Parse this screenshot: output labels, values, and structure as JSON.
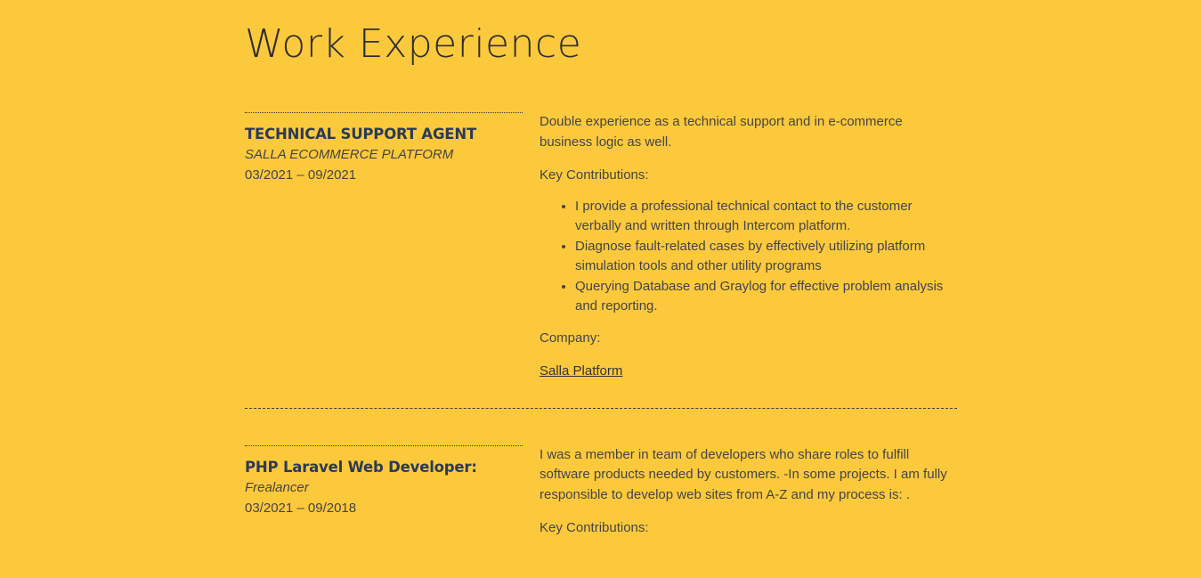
{
  "section": {
    "title": "Work Experience"
  },
  "jobs": [
    {
      "title": "TECHNICAL SUPPORT AGENT",
      "company": "SALLA ECOMMERCE PLATFORM",
      "dates": "03/2021 – 09/2021",
      "intro": "Double experience as a technical support and in e-commerce business logic as well.",
      "key_label": "Key Contributions:",
      "contributions": [
        "I provide a professional technical contact to the customer verbally and written through Intercom platform.",
        "Diagnose fault-related cases by effectively utilizing platform simulation tools and other utility programs",
        "Querying Database and Graylog for effective problem analysis and reporting."
      ],
      "company_label": "Company:",
      "company_link": "Salla Platform"
    },
    {
      "title": "PHP Laravel Web Developer:",
      "company": "Frealancer",
      "dates": "03/2021 – 09/2018",
      "intro": "I was a member in team of developers who share roles to fulfill software products needed by customers. -In some projects. I am fully responsible to develop web sites from A-Z and my process is: .",
      "key_label": "Key Contributions:"
    }
  ]
}
